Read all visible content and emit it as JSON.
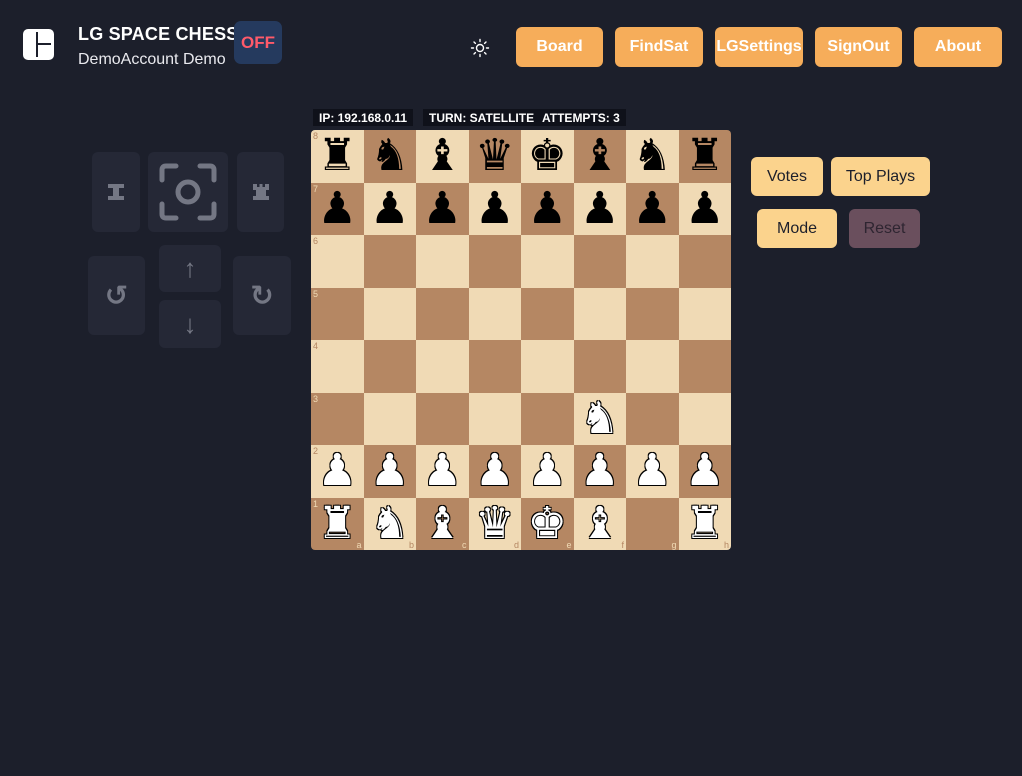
{
  "header": {
    "title": "LG SPACE CHESS",
    "user": "DemoAccount Demo",
    "status": "OFF",
    "theme_icon": "sun-icon"
  },
  "nav": {
    "board": "Board",
    "findsat": "FindSat",
    "lgsettings": "LGSettings",
    "signout": "SignOut",
    "about": "About"
  },
  "colors": {
    "background": "#1c1f2b",
    "nav_button": "#f6ad5a",
    "side_button": "#fbd38d",
    "reset_button": "#6a4f5d",
    "status_off_text": "#ff5a6a",
    "light_square": "#f0dab5",
    "dark_square": "#b58763"
  },
  "info": {
    "ip": "IP: 192.168.0.11",
    "turn": "TURN: SATELLITE",
    "attempts": "ATTEMPTS: 3"
  },
  "controls": {
    "icons": [
      "rook-left-icon",
      "camera-focus-icon",
      "rook-right-icon",
      "rotate-left-icon",
      "arrow-up-icon",
      "arrow-down-icon",
      "rotate-right-icon"
    ]
  },
  "board": {
    "files": [
      "a",
      "b",
      "c",
      "d",
      "e",
      "f",
      "g",
      "h"
    ],
    "ranks": [
      "8",
      "7",
      "6",
      "5",
      "4",
      "3",
      "2",
      "1"
    ],
    "rows": [
      [
        [
          "b",
          "♜"
        ],
        [
          "b",
          "♞"
        ],
        [
          "b",
          "♝"
        ],
        [
          "b",
          "♛"
        ],
        [
          "b",
          "♚"
        ],
        [
          "b",
          "♝"
        ],
        [
          "b",
          "♞"
        ],
        [
          "b",
          "♜"
        ]
      ],
      [
        [
          "b",
          "♟"
        ],
        [
          "b",
          "♟"
        ],
        [
          "b",
          "♟"
        ],
        [
          "b",
          "♟"
        ],
        [
          "b",
          "♟"
        ],
        [
          "b",
          "♟"
        ],
        [
          "b",
          "♟"
        ],
        [
          "b",
          "♟"
        ]
      ],
      [
        null,
        null,
        null,
        null,
        null,
        null,
        null,
        null
      ],
      [
        null,
        null,
        null,
        null,
        null,
        null,
        null,
        null
      ],
      [
        null,
        null,
        null,
        null,
        null,
        null,
        null,
        null
      ],
      [
        null,
        null,
        null,
        null,
        null,
        [
          "w",
          "♞"
        ],
        null,
        null
      ],
      [
        [
          "w",
          "♟"
        ],
        [
          "w",
          "♟"
        ],
        [
          "w",
          "♟"
        ],
        [
          "w",
          "♟"
        ],
        [
          "w",
          "♟"
        ],
        [
          "w",
          "♟"
        ],
        [
          "w",
          "♟"
        ],
        [
          "w",
          "♟"
        ]
      ],
      [
        [
          "w",
          "♜"
        ],
        [
          "w",
          "♞"
        ],
        [
          "w",
          "♝"
        ],
        [
          "w",
          "♛"
        ],
        [
          "w",
          "♚"
        ],
        [
          "w",
          "♝"
        ],
        null,
        [
          "w",
          "♜"
        ]
      ]
    ]
  },
  "side": {
    "votes": "Votes",
    "top_plays": "Top Plays",
    "mode": "Mode",
    "reset": "Reset"
  }
}
